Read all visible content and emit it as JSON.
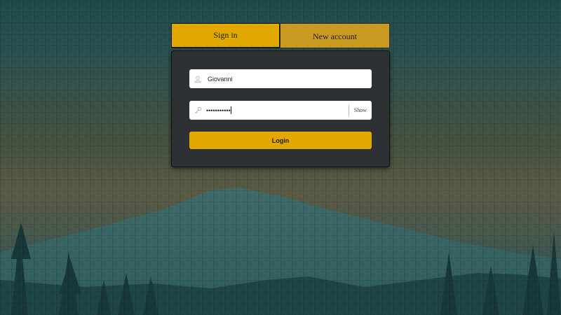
{
  "tabs": {
    "signin_label": "Sign in",
    "newaccount_label": "New account"
  },
  "form": {
    "username_value": "Giovanni",
    "password_masked": "•••••••••••",
    "show_label": "Show",
    "login_label": "Login"
  },
  "icons": {
    "user": "user-icon",
    "key": "key-icon"
  },
  "colors": {
    "accent": "#e0a800",
    "accent_inactive": "#c89a22",
    "panel": "#2e3133"
  }
}
